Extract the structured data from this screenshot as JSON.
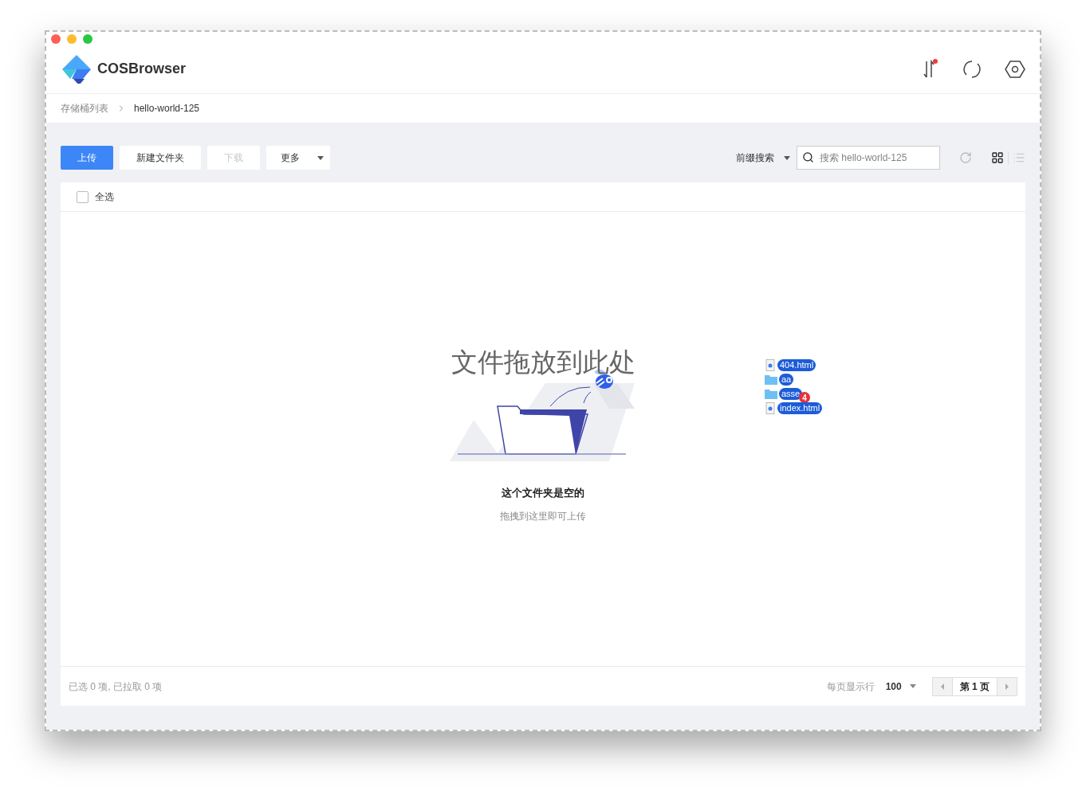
{
  "app": {
    "title": "COSBrowser"
  },
  "breadcrumb": [
    {
      "label": "存储桶列表"
    },
    {
      "label": "hello-world-125"
    }
  ],
  "header_icons": {
    "transfer_notification": true
  },
  "toolbar": {
    "buttons": [
      {
        "label": "上传",
        "kind": "primary",
        "disabled": false
      },
      {
        "label": "新建文件夹",
        "kind": "default",
        "disabled": false
      },
      {
        "label": "下载",
        "kind": "default",
        "disabled": true
      },
      {
        "label": "更多",
        "kind": "dropdown",
        "disabled": false
      }
    ],
    "search_mode": "前缀搜索",
    "search": {
      "placeholder": "搜索 hello-world-125"
    },
    "views": [
      {
        "kind": "grid",
        "selected": true
      },
      {
        "kind": "list",
        "selected": false
      }
    ]
  },
  "select_all": {
    "label": "全选",
    "checked": false
  },
  "empty": {
    "drop_hint": "文件拖放到此处",
    "title": "这个文件夹是空的",
    "subtitle": "拖拽到这里即可上传"
  },
  "drag_items": [
    {
      "name": "404.html",
      "kind": "file"
    },
    {
      "name": "aa",
      "kind": "folder"
    },
    {
      "name": "asse",
      "kind": "folder"
    },
    {
      "name": "index.html",
      "kind": "file"
    }
  ],
  "drag_count": "4",
  "footer": {
    "status": "已选 0 项, 已拉取 0 项",
    "page_size_label": "每页显示行",
    "page_size": "100",
    "page": "第 1 页"
  }
}
